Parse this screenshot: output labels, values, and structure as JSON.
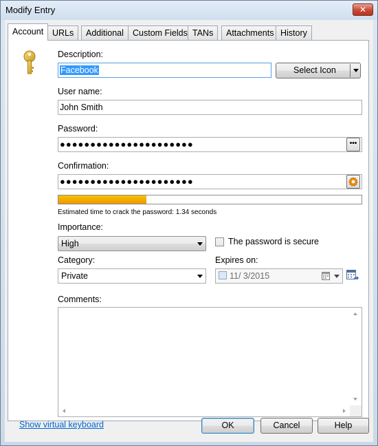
{
  "window": {
    "title": "Modify Entry",
    "close_glyph": "✕"
  },
  "tabs": [
    "Account",
    "URLs",
    "Additional",
    "Custom Fields",
    "TANs",
    "Attachments",
    "History"
  ],
  "account": {
    "description_label": "Description:",
    "description_value": "Facebook",
    "select_icon_label": "Select Icon",
    "username_label": "User name:",
    "username_value": "John Smith",
    "password_label": "Password:",
    "password_value": "●●●●●●●●●●●●●●●●●●●●●●",
    "confirmation_label": "Confirmation:",
    "confirmation_value": "●●●●●●●●●●●●●●●●●●●●●●",
    "strength_fraction": 0.29,
    "strength_colors": [
      "#f5c400",
      "#f29400"
    ],
    "crack_time_text": "Estimated time to crack the password: 1.34 seconds",
    "importance_label": "Importance:",
    "importance_value": "High",
    "secure_checkbox_label": "The password is secure",
    "category_label": "Category:",
    "category_value": "Private",
    "expires_label": "Expires on:",
    "expires_value": "11/  3/2015",
    "comments_label": "Comments:",
    "reveal_button_glyph": "•••"
  },
  "footer": {
    "virtual_keyboard_link": "Show virtual keyboard",
    "ok_label": "OK",
    "cancel_label": "Cancel",
    "help_label": "Help"
  },
  "icons": [
    "key-icon",
    "settings-gear-icon",
    "calendar-icon",
    "calendar-picker-icon"
  ]
}
